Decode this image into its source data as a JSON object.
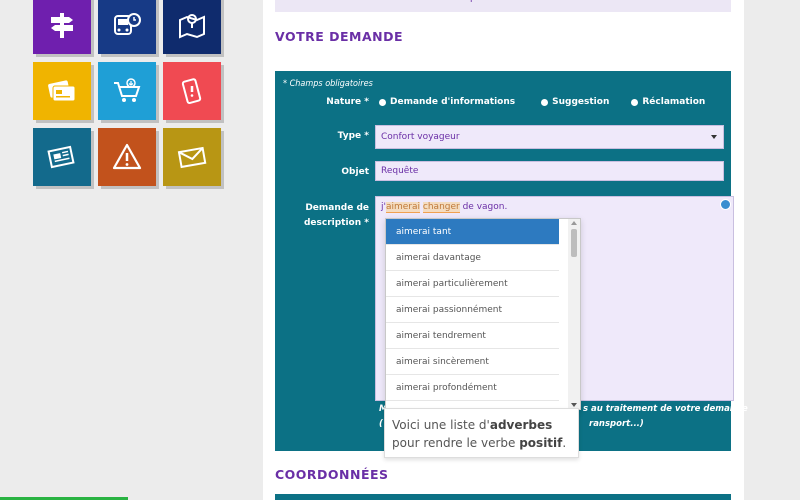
{
  "tiles": [
    {
      "icon": "signpost-icon",
      "color": "#6f1fae"
    },
    {
      "icon": "bus-clock-icon",
      "color": "#173a86"
    },
    {
      "icon": "map-pin-icon",
      "color": "#0f2b6d"
    },
    {
      "icon": "cards-icon",
      "color": "#f0b400"
    },
    {
      "icon": "cart-icon",
      "color": "#1f9fd6"
    },
    {
      "icon": "phone-alert-icon",
      "color": "#f04a52"
    },
    {
      "icon": "newspaper-icon",
      "color": "#136a8c"
    },
    {
      "icon": "warning-icon",
      "color": "#c2521c"
    },
    {
      "icon": "envelope-icon",
      "color": "#b89614"
    }
  ],
  "top_band_text": "p",
  "section_demande": "VOTRE DEMANDE",
  "section_coordonnees": "COORDONNÉES",
  "form": {
    "required_note": "* Champs obligatoires",
    "nature_label": "Nature *",
    "nature_options": [
      "Demande d'informations",
      "Suggestion",
      "Réclamation"
    ],
    "type_label": "Type *",
    "type_value": "Confort voyageur",
    "objet_label": "Objet",
    "objet_value": "Requête",
    "description_label_1": "Demande de",
    "description_label_2": "description *",
    "description_text": {
      "part1": "j'",
      "part2": "aimerai",
      "part3": " ",
      "part4": "changer",
      "part5": " de vagon."
    },
    "note_line1_prefix": "M",
    "note_line1_suffix": "s au traitement de votre demande",
    "note_line2_prefix": "(",
    "note_line2_suffix": "ransport...)"
  },
  "suggestions": [
    "aimerai tant",
    "aimerai davantage",
    "aimerai particulièrement",
    "aimerai passionnément",
    "aimerai tendrement",
    "aimerai sincèrement",
    "aimerai profondément"
  ],
  "tooltip": {
    "t1": "Voici une liste d'",
    "t2": "adverbes",
    "t3": " pour rendre le verbe ",
    "t4": "positif",
    "t5": "."
  }
}
